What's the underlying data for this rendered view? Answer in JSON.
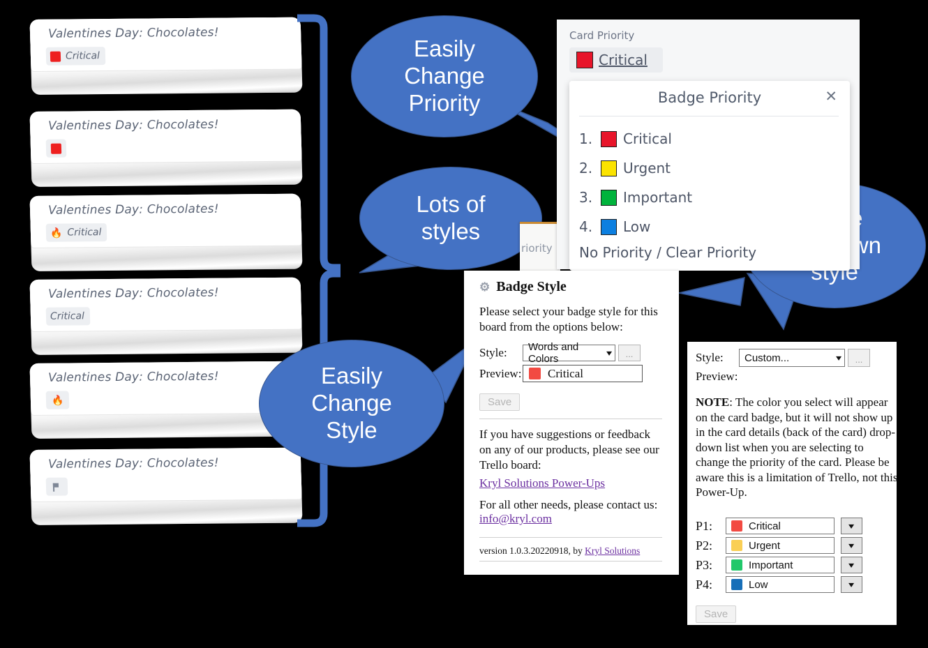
{
  "cards": [
    {
      "title": "Valentines Day: Chocolates!",
      "badge_kind": "swatch-text",
      "swatch": "#EE2020",
      "label": "Critical"
    },
    {
      "title": "Valentines Day: Chocolates!",
      "badge_kind": "swatch",
      "swatch": "#EE2020",
      "label": ""
    },
    {
      "title": "Valentines Day: Chocolates!",
      "badge_kind": "emoji-text",
      "emoji": "🔥",
      "label": "Critical"
    },
    {
      "title": "Valentines Day: Chocolates!",
      "badge_kind": "text",
      "label": "Critical"
    },
    {
      "title": "Valentines Day: Chocolates!",
      "badge_kind": "emoji",
      "emoji": "🔥",
      "label": ""
    },
    {
      "title": "Valentines Day: Chocolates!",
      "badge_kind": "flag",
      "label": ""
    }
  ],
  "callouts": {
    "change_priority": "Easily\nChange\nPriority",
    "lots_of_styles": "Lots of\nstyles",
    "change_style": "Easily\nChange\nStyle",
    "own_style": "Make\nyour own\nstyle"
  },
  "card_priority_panel": {
    "label": "Card Priority",
    "selected_swatch": "#E8152A",
    "selected_value": "Critical"
  },
  "behind_panel": {
    "partial_text": "riority"
  },
  "badge_priority_dialog": {
    "title": "Badge Priority",
    "close_icon": "close-icon",
    "items": [
      {
        "num": "1.",
        "swatch": "#E8152A",
        "label": "Critical"
      },
      {
        "num": "2.",
        "swatch": "#FBE300",
        "label": "Urgent"
      },
      {
        "num": "3.",
        "swatch": "#00B33C",
        "label": "Important"
      },
      {
        "num": "4.",
        "swatch": "#0C7FE0",
        "label": "Low"
      }
    ],
    "clear": "No Priority / Clear Priority"
  },
  "badge_style_panel": {
    "heading": "Badge Style",
    "gear_icon": "gear-icon",
    "description": "Please select your badge style for this board from the options below:",
    "style_label": "Style:",
    "style_value": "Words and Colors",
    "dots_button": "...",
    "preview_label": "Preview:",
    "preview_swatch": "#F24A42",
    "preview_text": "Critical",
    "save_label": "Save",
    "feedback_text": "If you have suggestions or feedback on any of our products, please see our Trello board:",
    "trello_link": "Kryl Solutions Power-Ups",
    "contact_text": "For all other needs, please contact us:",
    "email_link": "info@kryl.com",
    "version_prefix": "version 1.0.3.20220918, by ",
    "version_link": "Kryl Solutions"
  },
  "custom_panel": {
    "style_label": "Style:",
    "style_value": "Custom...",
    "dots_button": "...",
    "preview_label": "Preview:",
    "note_bold": "NOTE",
    "note_text": ": The color you select will appear on the card badge, but it will not show up in the card details (back of the card) drop-down list when you are selecting to change the priority of the card. Please be aware this is a limitation of Trello, not this Power-Up.",
    "rows": [
      {
        "key": "P1:",
        "swatch": "#F24A42",
        "label": "Critical"
      },
      {
        "key": "P2:",
        "swatch": "#FACF55",
        "label": "Urgent"
      },
      {
        "key": "P3:",
        "swatch": "#22C86B",
        "label": "Important"
      },
      {
        "key": "P4:",
        "swatch": "#176FB8",
        "label": "Low"
      }
    ],
    "save_label": "Save"
  },
  "colors": {
    "callout_blue": "#4472C4",
    "callout_blue_dark": "#37568f",
    "background": "#000000"
  }
}
